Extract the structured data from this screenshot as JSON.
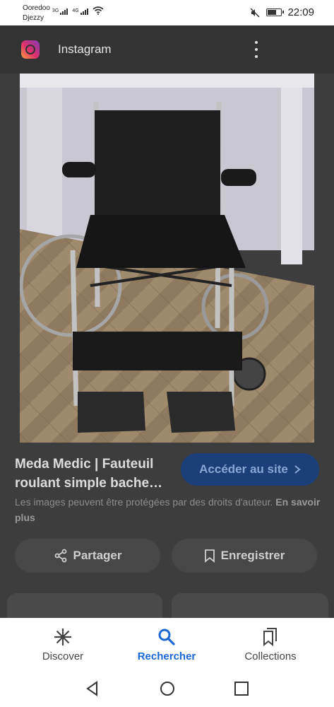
{
  "status_bar": {
    "carrier1": "Ooredoo",
    "carrier2": "Djezzy",
    "net1": "3G",
    "net2": "4G",
    "time": "22:09"
  },
  "header": {
    "app_title": "Instagram",
    "icon": "instagram-icon",
    "menu_icon": "more-vert-icon"
  },
  "result": {
    "title": "Meda Medic | Fauteuil roulant simple bache…",
    "visit_label": "Accéder au site",
    "copyright_text": "Les images peuvent être protégées par des droits d'auteur.",
    "learn_more": "En savoir plus",
    "share_label": "Partager",
    "save_label": "Enregistrer"
  },
  "bottom_nav": {
    "items": [
      {
        "label": "Discover",
        "icon": "asterisk-icon",
        "active": false
      },
      {
        "label": "Rechercher",
        "icon": "search-icon",
        "active": true
      },
      {
        "label": "Collections",
        "icon": "collections-icon",
        "active": false
      }
    ]
  },
  "colors": {
    "accent": "#1967d2",
    "overlay": "#3d3d3d"
  }
}
